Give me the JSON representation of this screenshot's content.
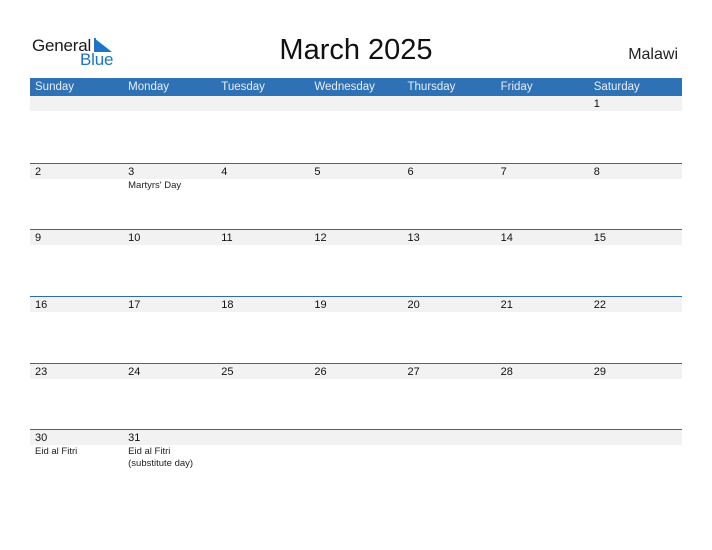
{
  "logo": {
    "word1": "General",
    "word2": "Blue",
    "brand_color": "#1f74c6",
    "icon": "triangle-flag-icon"
  },
  "title": "March 2025",
  "country": "Malawi",
  "colors": {
    "header_bg": "#2e72b5",
    "row_strip": "#f2f2f2",
    "row_border": "#2e6da7"
  },
  "weekdays": [
    "Sunday",
    "Monday",
    "Tuesday",
    "Wednesday",
    "Thursday",
    "Friday",
    "Saturday"
  ],
  "weeks": [
    [
      {
        "n": ""
      },
      {
        "n": ""
      },
      {
        "n": ""
      },
      {
        "n": ""
      },
      {
        "n": ""
      },
      {
        "n": ""
      },
      {
        "n": "1"
      }
    ],
    [
      {
        "n": "2"
      },
      {
        "n": "3",
        "h": "Martyrs' Day"
      },
      {
        "n": "4"
      },
      {
        "n": "5"
      },
      {
        "n": "6"
      },
      {
        "n": "7"
      },
      {
        "n": "8"
      }
    ],
    [
      {
        "n": "9"
      },
      {
        "n": "10"
      },
      {
        "n": "11"
      },
      {
        "n": "12"
      },
      {
        "n": "13"
      },
      {
        "n": "14"
      },
      {
        "n": "15"
      }
    ],
    [
      {
        "n": "16"
      },
      {
        "n": "17"
      },
      {
        "n": "18"
      },
      {
        "n": "19"
      },
      {
        "n": "20"
      },
      {
        "n": "21"
      },
      {
        "n": "22"
      }
    ],
    [
      {
        "n": "23"
      },
      {
        "n": "24"
      },
      {
        "n": "25"
      },
      {
        "n": "26"
      },
      {
        "n": "27"
      },
      {
        "n": "28"
      },
      {
        "n": "29"
      }
    ],
    [
      {
        "n": "30",
        "h": "Eid al Fitri"
      },
      {
        "n": "31",
        "h": "Eid al Fitri (substitute day)"
      },
      {
        "n": ""
      },
      {
        "n": ""
      },
      {
        "n": ""
      },
      {
        "n": ""
      },
      {
        "n": ""
      }
    ]
  ]
}
